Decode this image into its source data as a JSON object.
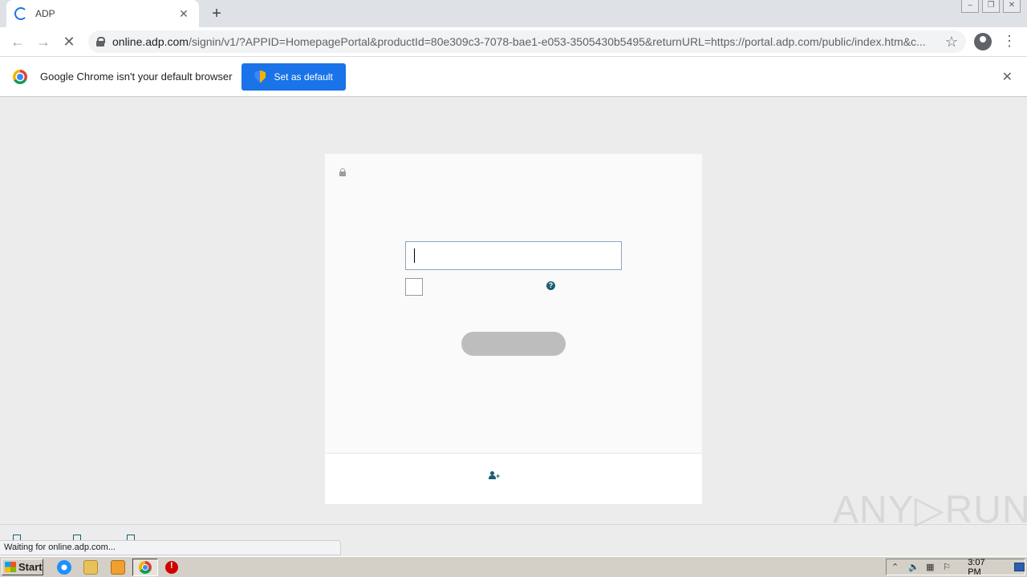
{
  "browser": {
    "tab_title": "ADP",
    "new_tab_symbol": "+",
    "tab_close_symbol": "✕",
    "url_host": "online.adp.com",
    "url_path": "/signin/v1/?APPID=HomepagePortal&productId=80e309c3-7078-bae1-e053-3505430b5495&returnURL=https://portal.adp.com/public/index.htm&c...",
    "back_symbol": "←",
    "forward_symbol": "→",
    "stop_symbol": "✕",
    "star_symbol": "☆",
    "menu_symbol": "⋮"
  },
  "infobar": {
    "message": "Google Chrome isn't your default browser",
    "button_label": "Set as default",
    "close_symbol": "✕",
    "accent_color": "#1a73e8"
  },
  "login": {
    "user_id_value": "",
    "next_button_color": "#bdbdbd",
    "help_symbol": "?",
    "create_account_plus": "+"
  },
  "status": {
    "text": "Waiting for online.adp.com..."
  },
  "watermark": {
    "text": "ANY▷RUN"
  },
  "taskbar": {
    "start_label": "Start",
    "clock": "3:07 PM",
    "tray_icons": [
      "show-hidden-icon",
      "volume-icon",
      "network-icon",
      "flag-icon"
    ]
  }
}
